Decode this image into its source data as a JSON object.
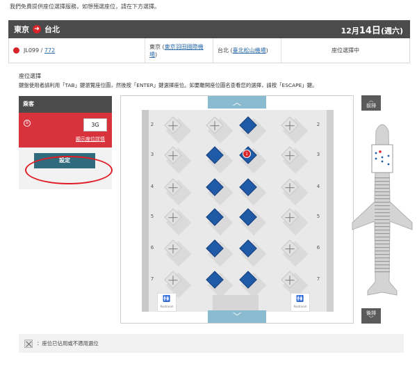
{
  "intro_text": "我們免費提供座位選擇服務，如想預選座位，請在下方選擇。",
  "route": {
    "origin": "東京",
    "destination": "台北",
    "date_prefix": "12月",
    "date_day": "14日",
    "date_weekday": "(週六)",
    "colors": {
      "bar": "#4b4b4b",
      "arrow": "#d8232a"
    }
  },
  "flight": {
    "number_prefix": "JL099 / ",
    "number_link": "772",
    "from_city": "東京 (",
    "from_airport": "東京羽田國際機場",
    "from_close": ")",
    "to_city": "台北 (",
    "to_airport": "臺北松山機場",
    "to_close": ")",
    "status": "座位選擇中"
  },
  "section": {
    "title": "座位選擇",
    "hint": "鍵盤使用者請利用「TAB」鍵瀏覽座位圖，然後按「ENTER」鍵選擇座位。如要離開座位圖名查看您的選擇，請按「ESCAPE」鍵。"
  },
  "passenger_panel": {
    "header": "乘客",
    "passenger_number": "①",
    "seat_value": "3G",
    "detail_link": "顯示座位詳情",
    "set_button": "設定"
  },
  "seat_map": {
    "rows": [
      "2",
      "3",
      "4",
      "5",
      "6",
      "7"
    ],
    "selected_badge": "1",
    "restroom_label": "Restroom",
    "colors": {
      "occupied": "#1f5aa6",
      "unavailable": "#e2e2e2",
      "scroll": "#8bbbd1"
    }
  },
  "nav": {
    "forward_label": "前排",
    "back_label": "後排"
  },
  "legend": {
    "unavailable_text": "：座位已佔用或不適用選位"
  }
}
